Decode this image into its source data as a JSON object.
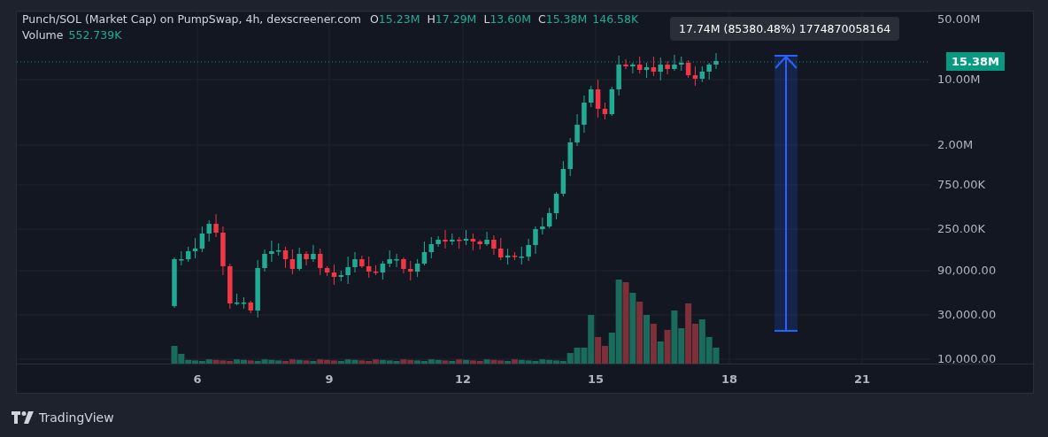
{
  "header": {
    "title": "Punch/SOL (Market Cap) on PumpSwap, 4h, dexscreener.com",
    "ohlc": [
      {
        "label": "O",
        "value": "15.23M"
      },
      {
        "label": "H",
        "value": "17.29M"
      },
      {
        "label": "L",
        "value": "13.60M"
      },
      {
        "label": "C",
        "value": "15.38M"
      }
    ],
    "change": "146.58K",
    "volume_label": "Volume",
    "volume_value": "552.739K"
  },
  "tooltip": "17.74M (85380.48%) 1774870058164",
  "price_axis": [
    "50.00M",
    "10.00M",
    "2.00M",
    "750.00K",
    "250.00K",
    "90,000.00",
    "30,000.00",
    "10,000.00"
  ],
  "last_price": "15.38M",
  "time_axis": [
    "6",
    "9",
    "12",
    "15",
    "18",
    "21"
  ],
  "footer": {
    "brand": "TradingView"
  }
}
